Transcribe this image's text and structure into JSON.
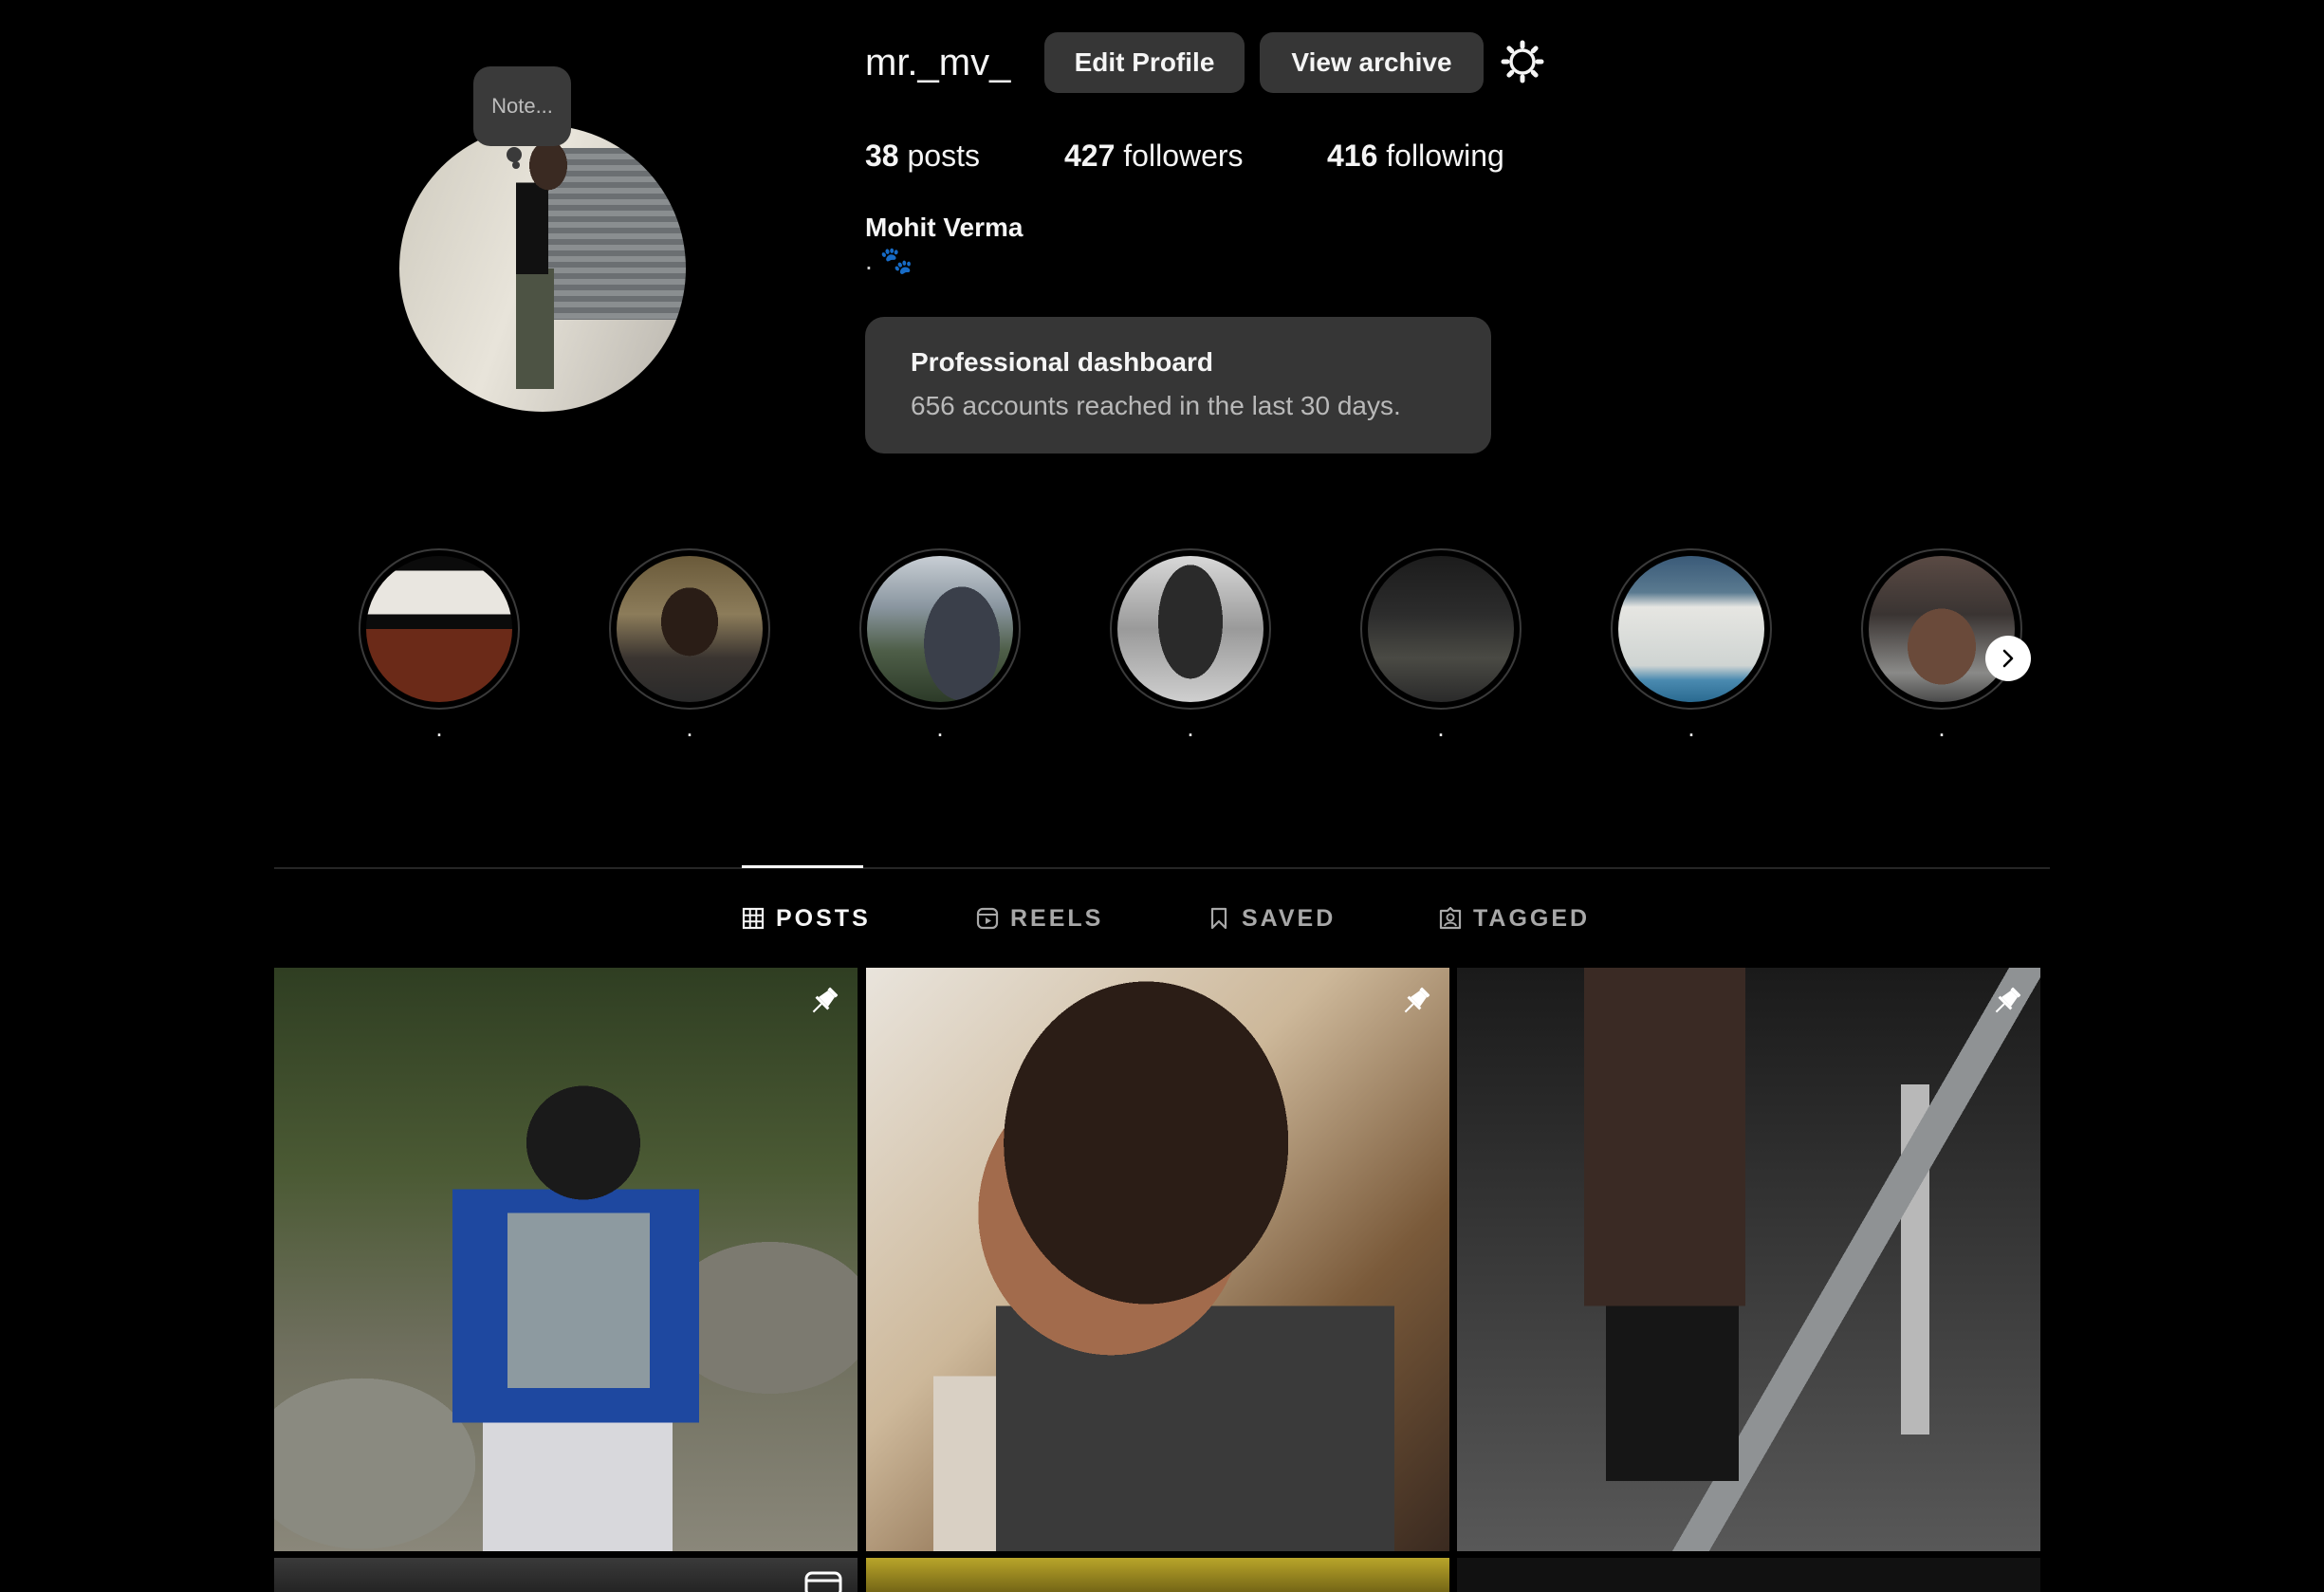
{
  "profile": {
    "username": "mr._mv_",
    "note_placeholder": "Note...",
    "edit_label": "Edit Profile",
    "archive_label": "View archive",
    "posts_count": "38",
    "posts_label": "posts",
    "followers_count": "427",
    "followers_label": "followers",
    "following_count": "416",
    "following_label": "following",
    "full_name": "Mohit Verma",
    "bio": ". 🐾"
  },
  "dashboard": {
    "title": "Professional dashboard",
    "subtitle": "656 accounts reached in the last 30 days."
  },
  "highlights": [
    {
      "label": "."
    },
    {
      "label": "."
    },
    {
      "label": "."
    },
    {
      "label": "."
    },
    {
      "label": "."
    },
    {
      "label": "."
    },
    {
      "label": "."
    }
  ],
  "tabs": {
    "posts": "POSTS",
    "reels": "REELS",
    "saved": "SAVED",
    "tagged": "TAGGED",
    "active": "posts"
  },
  "icons": {
    "settings": "gear-icon",
    "next": "chevron-right-icon",
    "pinned": "pin-icon",
    "reel": "reel-icon"
  },
  "colors": {
    "background": "#000000",
    "button": "#363636",
    "text": "#f5f5f5",
    "muted": "#a8a8a8"
  }
}
